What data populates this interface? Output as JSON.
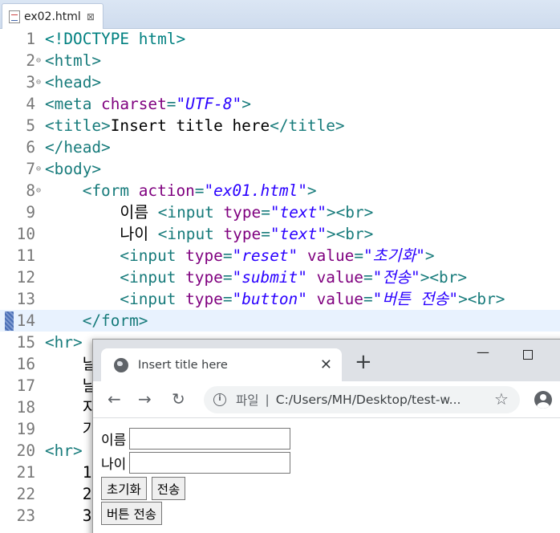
{
  "editor": {
    "tab_title": "ex02.html",
    "tab_close": "⊠",
    "lines": [
      {
        "n": "1",
        "fold": "",
        "parts": [
          [
            "d",
            "<!DOCTYPE html>"
          ]
        ]
      },
      {
        "n": "2",
        "fold": "⊖",
        "parts": [
          [
            "t",
            "<html>"
          ]
        ]
      },
      {
        "n": "3",
        "fold": "⊖",
        "parts": [
          [
            "t",
            "<head>"
          ]
        ]
      },
      {
        "n": "4",
        "fold": "",
        "parts": [
          [
            "t",
            "<meta "
          ],
          [
            "a",
            "charset"
          ],
          [
            "t",
            "="
          ],
          [
            "v",
            "\"UTF-8\""
          ],
          [
            "t",
            ">"
          ]
        ]
      },
      {
        "n": "5",
        "fold": "",
        "parts": [
          [
            "t",
            "<title>"
          ],
          [
            "x",
            "Insert title here"
          ],
          [
            "t",
            "</title>"
          ]
        ]
      },
      {
        "n": "6",
        "fold": "",
        "parts": [
          [
            "t",
            "</head>"
          ]
        ]
      },
      {
        "n": "7",
        "fold": "⊖",
        "parts": [
          [
            "t",
            "<body>"
          ]
        ]
      },
      {
        "n": "8",
        "fold": "⊖",
        "parts": [
          [
            "t",
            "    <form "
          ],
          [
            "a",
            "action"
          ],
          [
            "t",
            "="
          ],
          [
            "v",
            "\"ex01.html\""
          ],
          [
            "t",
            ">"
          ]
        ]
      },
      {
        "n": "9",
        "fold": "",
        "parts": [
          [
            "x",
            "        이름 "
          ],
          [
            "t",
            "<input "
          ],
          [
            "a",
            "type"
          ],
          [
            "t",
            "="
          ],
          [
            "v",
            "\"text\""
          ],
          [
            "t",
            "><br>"
          ]
        ]
      },
      {
        "n": "10",
        "fold": "",
        "parts": [
          [
            "x",
            "        나이 "
          ],
          [
            "t",
            "<input "
          ],
          [
            "a",
            "type"
          ],
          [
            "t",
            "="
          ],
          [
            "v",
            "\"text\""
          ],
          [
            "t",
            "><br>"
          ]
        ]
      },
      {
        "n": "11",
        "fold": "",
        "parts": [
          [
            "t",
            "        <input "
          ],
          [
            "a",
            "type"
          ],
          [
            "t",
            "="
          ],
          [
            "v",
            "\"reset\""
          ],
          [
            "t",
            " "
          ],
          [
            "a",
            "value"
          ],
          [
            "t",
            "="
          ],
          [
            "v",
            "\"초기화\""
          ],
          [
            "t",
            ">"
          ]
        ]
      },
      {
        "n": "12",
        "fold": "",
        "parts": [
          [
            "t",
            "        <input "
          ],
          [
            "a",
            "type"
          ],
          [
            "t",
            "="
          ],
          [
            "v",
            "\"submit\""
          ],
          [
            "t",
            " "
          ],
          [
            "a",
            "value"
          ],
          [
            "t",
            "="
          ],
          [
            "v",
            "\"전송\""
          ],
          [
            "t",
            "><br>"
          ]
        ]
      },
      {
        "n": "13",
        "fold": "",
        "parts": [
          [
            "t",
            "        <input "
          ],
          [
            "a",
            "type"
          ],
          [
            "t",
            "="
          ],
          [
            "v",
            "\"button\""
          ],
          [
            "t",
            " "
          ],
          [
            "a",
            "value"
          ],
          [
            "t",
            "="
          ],
          [
            "v",
            "\"버튼 전송\""
          ],
          [
            "t",
            "><br>"
          ]
        ]
      },
      {
        "n": "14",
        "fold": "",
        "parts": [
          [
            "t",
            "    </form>"
          ]
        ]
      },
      {
        "n": "15",
        "fold": "",
        "parts": [
          [
            "t",
            "<hr>"
          ]
        ]
      },
      {
        "n": "16",
        "fold": "",
        "parts": [
          [
            "x",
            "    날"
          ]
        ]
      },
      {
        "n": "17",
        "fold": "",
        "parts": [
          [
            "x",
            "    날"
          ]
        ]
      },
      {
        "n": "18",
        "fold": "",
        "parts": [
          [
            "x",
            "    지"
          ]
        ]
      },
      {
        "n": "19",
        "fold": "",
        "parts": [
          [
            "x",
            "    가"
          ]
        ]
      },
      {
        "n": "20",
        "fold": "",
        "parts": [
          [
            "t",
            "<hr>"
          ]
        ]
      },
      {
        "n": "21",
        "fold": "",
        "parts": [
          [
            "x",
            "    1"
          ]
        ]
      },
      {
        "n": "22",
        "fold": "",
        "parts": [
          [
            "x",
            "    2"
          ]
        ]
      },
      {
        "n": "23",
        "fold": "",
        "parts": [
          [
            "x",
            "    3"
          ]
        ]
      }
    ],
    "current_line": "14"
  },
  "browser": {
    "tab_title": "Insert title here",
    "tab_close": "✕",
    "new_tab": "+",
    "minimize": "—",
    "back": "←",
    "forward": "→",
    "reload": "↻",
    "info": "i",
    "origin_label": "파일",
    "separator": "|",
    "url": "C:/Users/MH/Desktop/test-w...",
    "star": "☆",
    "page": {
      "name_label": "이름",
      "name_value": "",
      "age_label": "나이",
      "age_value": "",
      "reset_label": "초기화",
      "submit_label": "전송",
      "button_label": "버튼 전송"
    }
  }
}
